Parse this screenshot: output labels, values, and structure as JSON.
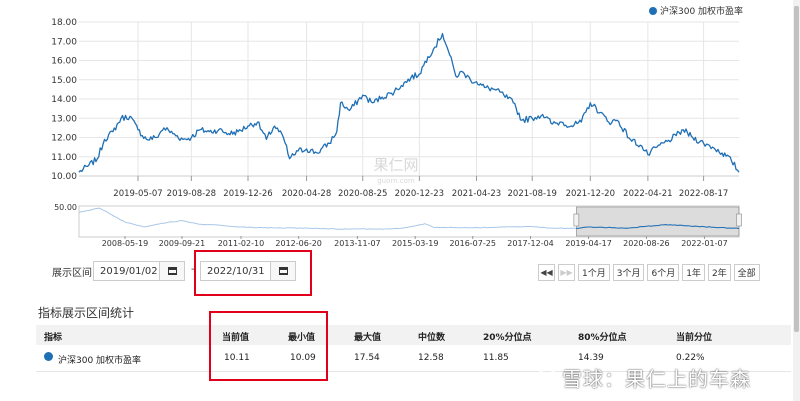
{
  "chart_data": {
    "type": "line",
    "series": [
      {
        "name": "沪深300 加权市盈率",
        "color": "#1f6fb5"
      }
    ],
    "ylim": [
      10.0,
      18.0
    ],
    "yticks": [
      "18.00",
      "17.00",
      "16.00",
      "15.00",
      "14.00",
      "13.00",
      "12.00",
      "11.00",
      "10.00"
    ],
    "x_ticks": [
      "2019-05-07",
      "2019-08-28",
      "2019-12-26",
      "2020-04-28",
      "2020-08-25",
      "2020-12-23",
      "2021-04-23",
      "2021-08-19",
      "2021-12-20",
      "2022-04-21",
      "2022-08-17"
    ],
    "x_range": [
      "2019-01-02",
      "2022-10-31"
    ],
    "points": [
      [
        "2019-01-02",
        10.2
      ],
      [
        "2019-01-20",
        10.5
      ],
      [
        "2019-02-10",
        10.9
      ],
      [
        "2019-02-25",
        11.9
      ],
      [
        "2019-03-15",
        12.3
      ],
      [
        "2019-04-01",
        13.0
      ],
      [
        "2019-04-20",
        13.1
      ],
      [
        "2019-05-07",
        12.4
      ],
      [
        "2019-05-25",
        11.9
      ],
      [
        "2019-06-15",
        12.0
      ],
      [
        "2019-07-01",
        12.5
      ],
      [
        "2019-07-20",
        12.2
      ],
      [
        "2019-08-10",
        11.9
      ],
      [
        "2019-08-28",
        12.0
      ],
      [
        "2019-09-15",
        12.4
      ],
      [
        "2019-10-05",
        12.3
      ],
      [
        "2019-10-25",
        12.4
      ],
      [
        "2019-11-15",
        12.2
      ],
      [
        "2019-12-05",
        12.3
      ],
      [
        "2019-12-26",
        12.6
      ],
      [
        "2020-01-15",
        12.8
      ],
      [
        "2020-02-03",
        11.9
      ],
      [
        "2020-02-20",
        12.6
      ],
      [
        "2020-03-10",
        12.0
      ],
      [
        "2020-03-23",
        10.9
      ],
      [
        "2020-04-10",
        11.3
      ],
      [
        "2020-04-28",
        11.4
      ],
      [
        "2020-05-20",
        11.2
      ],
      [
        "2020-06-15",
        11.7
      ],
      [
        "2020-07-01",
        12.3
      ],
      [
        "2020-07-09",
        13.8
      ],
      [
        "2020-07-28",
        13.4
      ],
      [
        "2020-08-25",
        14.2
      ],
      [
        "2020-09-15",
        13.8
      ],
      [
        "2020-10-05",
        14.1
      ],
      [
        "2020-10-25",
        14.3
      ],
      [
        "2020-11-15",
        14.7
      ],
      [
        "2020-12-05",
        15.1
      ],
      [
        "2020-12-23",
        15.3
      ],
      [
        "2021-01-10",
        16.2
      ],
      [
        "2021-01-25",
        16.7
      ],
      [
        "2021-02-10",
        17.4
      ],
      [
        "2021-02-25",
        16.3
      ],
      [
        "2021-03-10",
        15.2
      ],
      [
        "2021-03-25",
        15.4
      ],
      [
        "2021-04-10",
        15.0
      ],
      [
        "2021-04-23",
        14.9
      ],
      [
        "2021-05-10",
        14.6
      ],
      [
        "2021-05-31",
        14.5
      ],
      [
        "2021-06-20",
        14.2
      ],
      [
        "2021-07-10",
        13.8
      ],
      [
        "2021-07-28",
        12.9
      ],
      [
        "2021-08-19",
        13.0
      ],
      [
        "2021-09-10",
        13.2
      ],
      [
        "2021-10-01",
        12.7
      ],
      [
        "2021-10-20",
        12.8
      ],
      [
        "2021-11-10",
        12.6
      ],
      [
        "2021-12-01",
        12.8
      ],
      [
        "2021-12-20",
        13.8
      ],
      [
        "2022-01-10",
        13.3
      ],
      [
        "2022-01-28",
        12.8
      ],
      [
        "2022-02-15",
        12.9
      ],
      [
        "2022-03-15",
        11.9
      ],
      [
        "2022-04-05",
        11.6
      ],
      [
        "2022-04-21",
        11.1
      ],
      [
        "2022-05-10",
        11.5
      ],
      [
        "2022-06-01",
        11.8
      ],
      [
        "2022-06-20",
        12.1
      ],
      [
        "2022-07-05",
        12.4
      ],
      [
        "2022-07-25",
        12.0
      ],
      [
        "2022-08-17",
        11.7
      ],
      [
        "2022-09-05",
        11.5
      ],
      [
        "2022-09-25",
        11.2
      ],
      [
        "2022-10-15",
        10.8
      ],
      [
        "2022-10-31",
        10.2
      ]
    ]
  },
  "navigator": {
    "ytick": "50.00",
    "x_ticks": [
      "2008-05-19",
      "2009-09-21",
      "2011-02-10",
      "2012-06-20",
      "2013-11-07",
      "2015-03-19",
      "2016-07-25",
      "2017-12-04",
      "2019-04-17",
      "2020-08-26",
      "2022-01-07"
    ],
    "x_range": [
      "2007-04-20",
      "2022-10-31"
    ],
    "selected": [
      "2019-01-02",
      "2022-10-31"
    ],
    "points": [
      [
        "2007-04-20",
        40
      ],
      [
        "2007-10-15",
        48
      ],
      [
        "2008-05-19",
        22
      ],
      [
        "2008-11-01",
        13
      ],
      [
        "2009-04-01",
        20
      ],
      [
        "2009-09-21",
        25
      ],
      [
        "2010-03-01",
        18
      ],
      [
        "2010-09-01",
        16
      ],
      [
        "2011-02-10",
        13
      ],
      [
        "2011-08-01",
        12
      ],
      [
        "2012-02-01",
        11
      ],
      [
        "2012-06-20",
        11
      ],
      [
        "2013-01-01",
        10
      ],
      [
        "2013-06-01",
        9
      ],
      [
        "2013-11-07",
        9.5
      ],
      [
        "2014-06-01",
        9
      ],
      [
        "2014-12-01",
        11
      ],
      [
        "2015-03-19",
        15
      ],
      [
        "2015-06-10",
        19
      ],
      [
        "2015-09-01",
        12
      ],
      [
        "2016-01-01",
        12
      ],
      [
        "2016-07-25",
        11.5
      ],
      [
        "2017-03-01",
        12.5
      ],
      [
        "2017-12-04",
        14
      ],
      [
        "2018-06-01",
        11
      ],
      [
        "2019-01-02",
        10.2
      ],
      [
        "2019-04-17",
        12.9
      ],
      [
        "2020-03-23",
        10.9
      ],
      [
        "2020-08-26",
        14.2
      ],
      [
        "2021-02-10",
        17.4
      ],
      [
        "2022-01-07",
        13.3
      ],
      [
        "2022-10-31",
        10.2
      ]
    ]
  },
  "watermark_main": "果仁网",
  "watermark_url": "guorn.com",
  "controls": {
    "range_label": "展示区间",
    "start_date": "2019/01/02",
    "end_date": "2022/10/31",
    "dash": "-",
    "buttons": [
      "1个月",
      "3个月",
      "6个月",
      "1年",
      "2年",
      "全部"
    ],
    "prev_icon": "double-left-arrow",
    "next_icon": "double-right-arrow"
  },
  "stats": {
    "title": "指标展示区间统计",
    "headers": [
      "指标",
      "当前值",
      "最小值",
      "最大值",
      "中位数",
      "20%分位点",
      "80%分位点",
      "当前分位"
    ],
    "row": [
      "沪深300 加权市盈率",
      "10.11",
      "10.09",
      "17.54",
      "12.58",
      "11.85",
      "14.39",
      "0.22%"
    ]
  },
  "footer_watermark": "雪球：果仁上的车森",
  "colors": {
    "series": "#1f6fb5",
    "navigator": "#a9c7e8",
    "highlight": "#e0001b",
    "header_bg": "#f2f2f2"
  }
}
